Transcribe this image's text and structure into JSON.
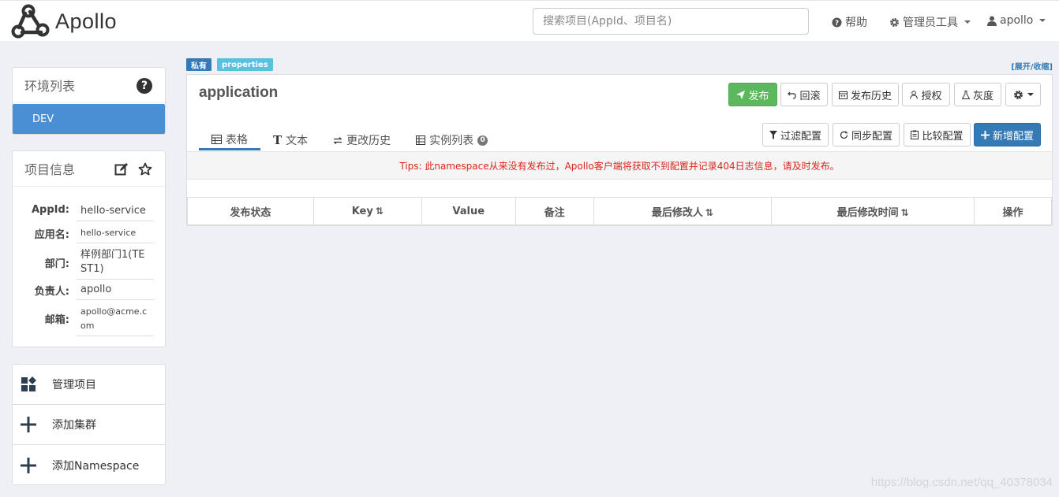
{
  "navbar": {
    "brand": "Apollo",
    "search_placeholder": "搜索项目(AppId、项目名)",
    "help": "帮助",
    "admin_tools": "管理员工具",
    "user": "apollo"
  },
  "env_panel": {
    "title": "环境列表",
    "environments": [
      "DEV"
    ]
  },
  "project_info": {
    "title": "项目信息",
    "rows": [
      {
        "label": "AppId:",
        "value": "hello-service"
      },
      {
        "label": "应用名:",
        "value": "hello-service"
      },
      {
        "label": "部门:",
        "value": "样例部门1(TEST1)"
      },
      {
        "label": "负责人:",
        "value": "apollo"
      },
      {
        "label": "邮箱:",
        "value": "apollo@acme.com"
      }
    ]
  },
  "actions": [
    {
      "label": "管理项目",
      "icon": "grid-icon"
    },
    {
      "label": "添加集群",
      "icon": "plus-icon"
    },
    {
      "label": "添加Namespace",
      "icon": "plus-icon"
    }
  ],
  "namespace": {
    "tag_private": "私有",
    "tag_format": "properties",
    "expand_toggle": "[展开/收缩]",
    "name": "application",
    "buttons": {
      "publish": "发布",
      "rollback": "回滚",
      "history": "发布历史",
      "grant": "授权",
      "gray": "灰度"
    },
    "tabs": [
      "表格",
      "文本",
      "更改历史",
      "实例列表"
    ],
    "instance_count": "0",
    "tools": {
      "filter": "过滤配置",
      "sync": "同步配置",
      "compare": "比较配置",
      "add": "新增配置"
    },
    "tips": "Tips: 此namespace从来没有发布过，Apollo客户端将获取不到配置并记录404日志信息，请及时发布。",
    "table_headers": [
      "发布状态",
      "Key",
      "Value",
      "备注",
      "最后修改人",
      "最后修改时间",
      "操作"
    ]
  },
  "watermark": "https://blog.csdn.net/qq_40378034"
}
